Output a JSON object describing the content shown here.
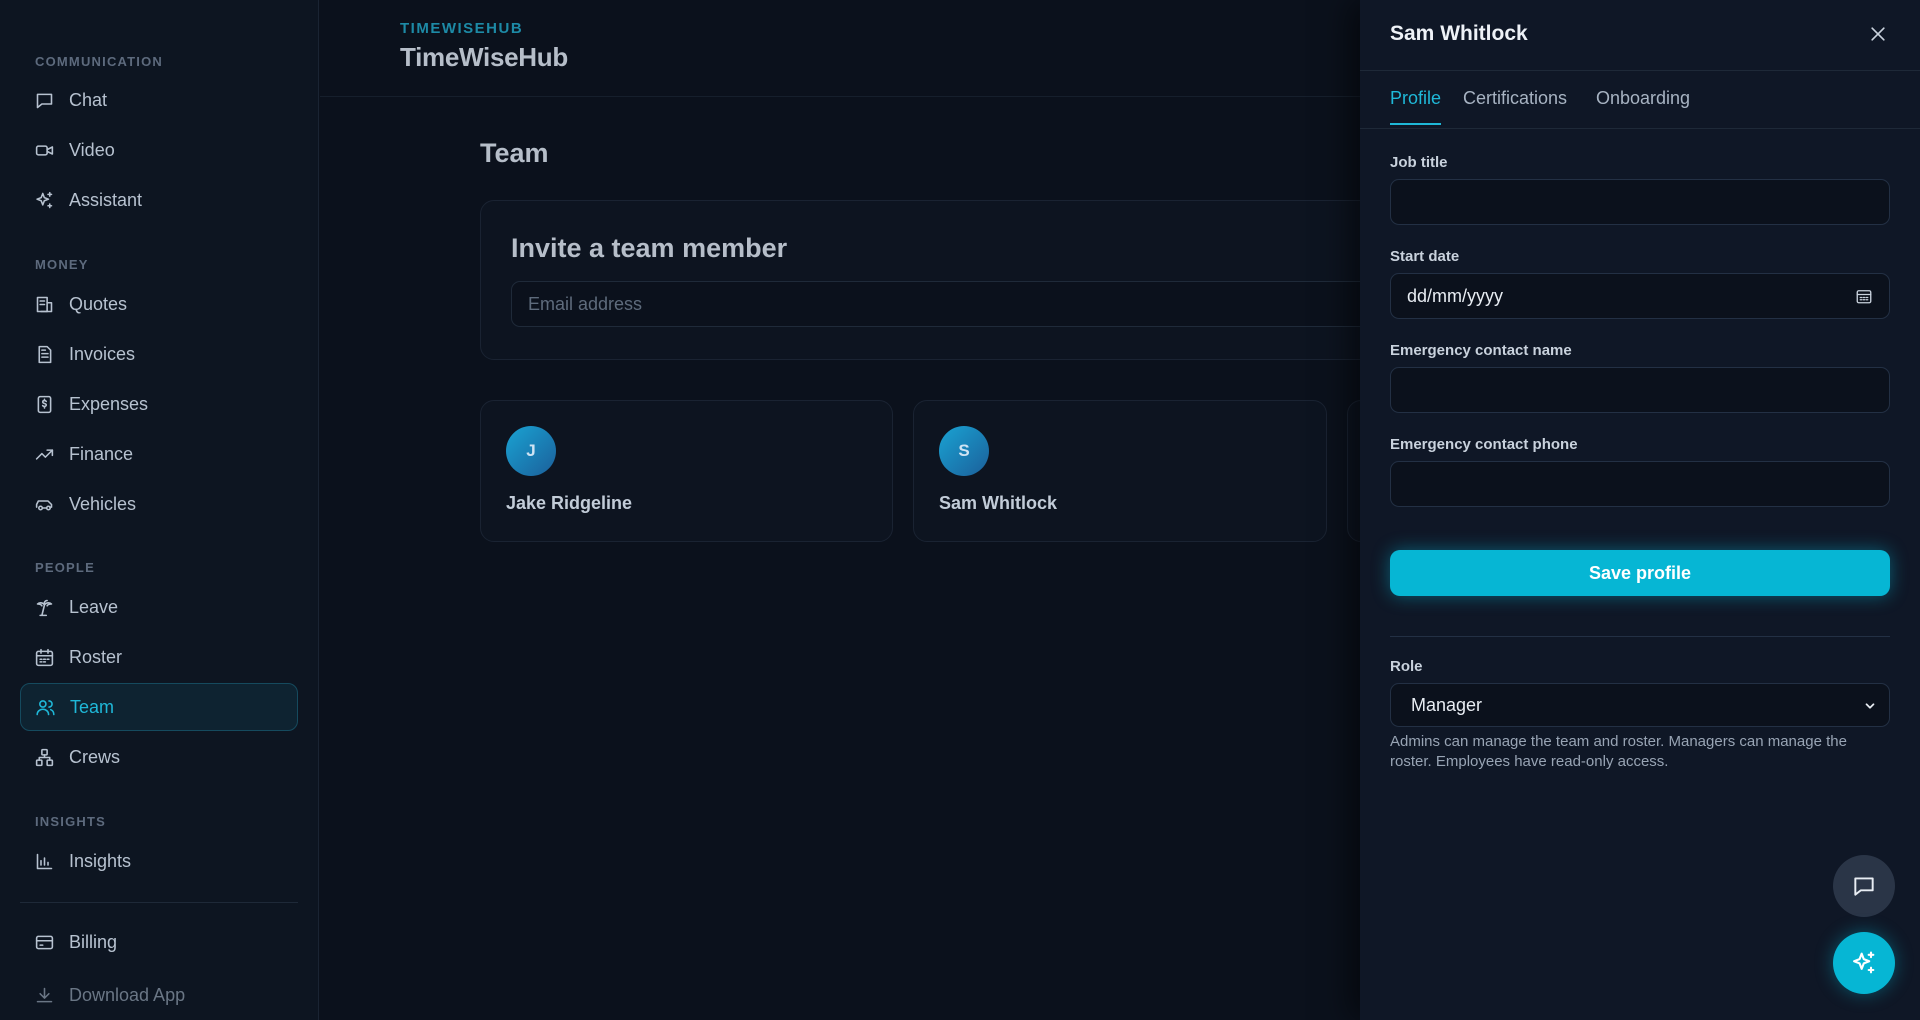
{
  "sidebar": {
    "sections": [
      {
        "title": "COMMUNICATION",
        "items": [
          {
            "label": "Chat",
            "icon": "chat-icon"
          },
          {
            "label": "Video",
            "icon": "video-icon"
          },
          {
            "label": "Assistant",
            "icon": "sparkles-icon"
          }
        ]
      },
      {
        "title": "MONEY",
        "items": [
          {
            "label": "Quotes",
            "icon": "quote-icon"
          },
          {
            "label": "Invoices",
            "icon": "invoice-icon"
          },
          {
            "label": "Expenses",
            "icon": "expense-icon"
          },
          {
            "label": "Finance",
            "icon": "trend-icon"
          },
          {
            "label": "Vehicles",
            "icon": "car-icon"
          }
        ]
      },
      {
        "title": "PEOPLE",
        "items": [
          {
            "label": "Leave",
            "icon": "palm-tree-icon"
          },
          {
            "label": "Roster",
            "icon": "calendar-icon"
          },
          {
            "label": "Team",
            "icon": "users-icon",
            "active": true
          },
          {
            "label": "Crews",
            "icon": "network-icon"
          }
        ]
      },
      {
        "title": "INSIGHTS",
        "items": [
          {
            "label": "Insights",
            "icon": "bar-chart-icon"
          }
        ]
      }
    ],
    "footer": [
      {
        "label": "Billing",
        "icon": "credit-card-icon"
      },
      {
        "label": "Download App",
        "icon": "download-icon"
      }
    ]
  },
  "header": {
    "brand_small": "TIMEWISEHUB",
    "brand_big": "TimeWiseHub"
  },
  "main": {
    "title": "Team",
    "invite": {
      "title": "Invite a team member",
      "email_placeholder": "Email address"
    },
    "members": [
      {
        "initial": "J",
        "name": "Jake Ridgeline"
      },
      {
        "initial": "S",
        "name": "Sam Whitlock"
      }
    ]
  },
  "panel": {
    "title": "Sam Whitlock",
    "tabs": [
      "Profile",
      "Certifications",
      "Onboarding"
    ],
    "active_tab": "Profile",
    "fields": {
      "job_title": {
        "label": "Job title",
        "value": ""
      },
      "start_date": {
        "label": "Start date",
        "value": "dd/mm/yyyy"
      },
      "emergency_name": {
        "label": "Emergency contact name",
        "value": ""
      },
      "emergency_phone": {
        "label": "Emergency contact phone",
        "value": ""
      }
    },
    "save_label": "Save profile",
    "role": {
      "label": "Role",
      "value": "Manager",
      "help": "Admins can manage the team and roster. Managers can manage the roster. Employees have read-only access."
    }
  },
  "colors": {
    "accent": "#06b6d4",
    "background": "#0b111c",
    "panel": "#0f1726"
  }
}
